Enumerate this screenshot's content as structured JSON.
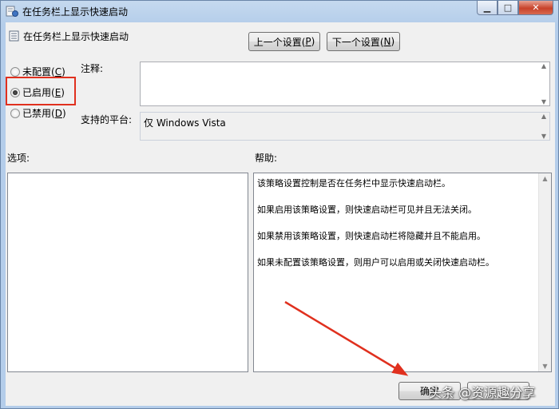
{
  "window": {
    "title": "在任务栏上显示快速启动",
    "controls": {
      "minimize": "▁",
      "maximize": "□",
      "close": "✕"
    }
  },
  "header": {
    "title": "在任务栏上显示快速启动",
    "prev_label": "上一个设置(",
    "prev_key": "P",
    "next_label": "下一个设置(",
    "next_key": "N",
    "close_paren": ")"
  },
  "state": {
    "options": [
      {
        "label": "未配置(",
        "key": "C",
        "checked": false
      },
      {
        "label": "已启用(",
        "key": "E",
        "checked": true
      },
      {
        "label": "已禁用(",
        "key": "D",
        "checked": false
      }
    ],
    "close_paren": ")"
  },
  "comment": {
    "label": "注释:",
    "value": ""
  },
  "platform": {
    "label": "支持的平台:",
    "value": "仅 Windows Vista"
  },
  "options_section": {
    "label": "选项:"
  },
  "help_section": {
    "label": "帮助:",
    "lines": [
      "该策略设置控制是否在任务栏中显示快速启动栏。",
      "如果启用该策略设置，则快速启动栏可见并且无法关闭。",
      "如果禁用该策略设置，则快速启动栏将隐藏并且不能启用。",
      "如果未配置该策略设置，则用户可以启用或关闭快速启动栏。"
    ]
  },
  "footer": {
    "ok_label": "确定"
  },
  "watermark": "头条 @资源趣分享",
  "colors": {
    "highlight_border": "#e0301e",
    "arrow": "#e0301e"
  }
}
